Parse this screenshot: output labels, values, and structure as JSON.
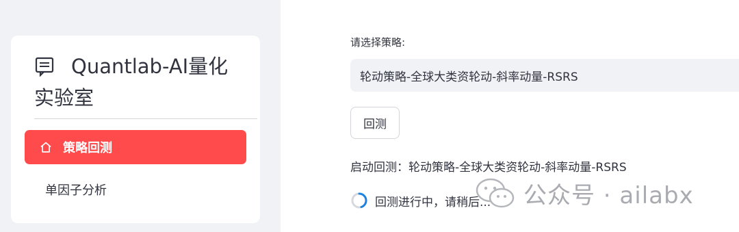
{
  "sidebar": {
    "app_title": "Quantlab-AI量化实验室",
    "menu": [
      {
        "label": "策略回测",
        "icon": "home-icon",
        "active": true
      },
      {
        "label": "单因子分析",
        "active": false
      }
    ]
  },
  "main": {
    "select_label": "请选择策略:",
    "selected_strategy": "轮动策略-全球大类资轮动-斜率动量-RSRS",
    "backtest_button": "回测",
    "status_text": "启动回测：轮动策略-全球大类资轮动-斜率动量-RSRS",
    "progress_text": "回测进行中，请稍后..."
  },
  "watermark": {
    "text": "公众号 · ailabx",
    "icon": "wechat-icon"
  },
  "colors": {
    "accent": "#ff4b4b",
    "sidebar_bg": "#f0f2f6",
    "text": "#31333f",
    "spinner": "#1c83e1"
  }
}
